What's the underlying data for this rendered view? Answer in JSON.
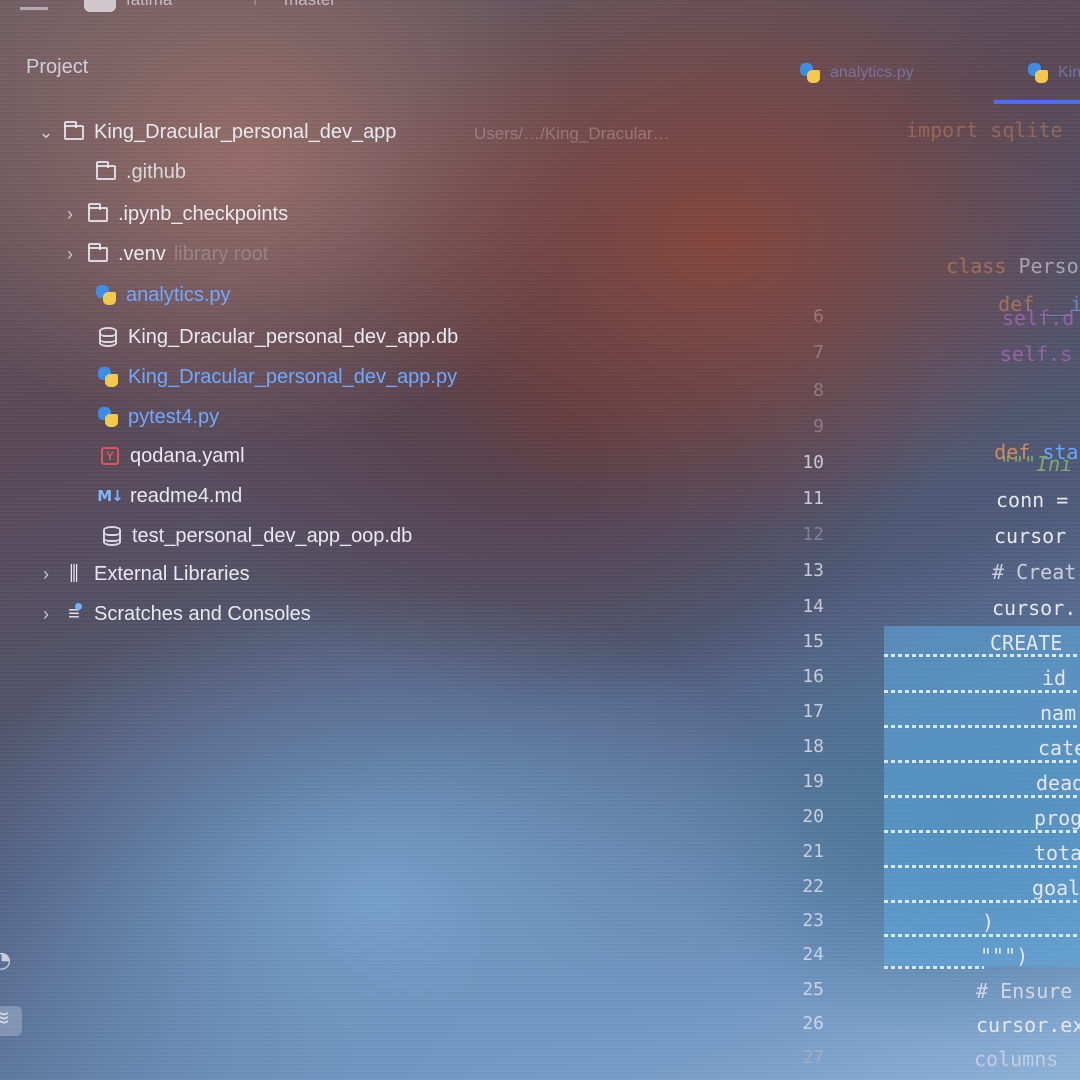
{
  "topbar": {
    "project_name": "fatima",
    "branch": "master"
  },
  "project_panel": {
    "title": "Project",
    "root": {
      "name": "King_Dracular_personal_dev_app",
      "path_hint": "Users/…/King_Dracular…"
    },
    "items": [
      {
        "name": ".github",
        "type": "folder"
      },
      {
        "name": ".ipynb_checkpoints",
        "type": "folder"
      },
      {
        "name": ".venv",
        "type": "folder",
        "suffix": "library root"
      },
      {
        "name": "analytics.py",
        "type": "python"
      },
      {
        "name": "King_Dracular_personal_dev_app.db",
        "type": "database"
      },
      {
        "name": "King_Dracular_personal_dev_app.py",
        "type": "python"
      },
      {
        "name": "pytest4.py",
        "type": "python"
      },
      {
        "name": "qodana.yaml",
        "type": "yaml"
      },
      {
        "name": "readme4.md",
        "type": "markdown"
      },
      {
        "name": "test_personal_dev_app_oop.db",
        "type": "database"
      }
    ],
    "external_libraries": "External Libraries",
    "scratches": "Scratches and Consoles"
  },
  "editor": {
    "tabs": [
      {
        "label": "analytics.py"
      },
      {
        "label": "King"
      }
    ],
    "line_numbers": [
      "6",
      "7",
      "8",
      "9",
      "10",
      "11",
      "12",
      "13",
      "14",
      "15",
      "16",
      "17",
      "18",
      "19",
      "20",
      "21",
      "22",
      "23",
      "24",
      "25",
      "26",
      "27"
    ],
    "code": {
      "import": "import sqlite",
      "class_kw": "class",
      "class_name": "Personal",
      "def_init_kw": "def",
      "def_init_name": "__init",
      "self_d": "self.d",
      "self_s": "self.s",
      "def_start_kw": "def",
      "def_start_name": "start_",
      "docstring": "\"\"\"Ini",
      "conn": "conn =",
      "cursor": "cursor",
      "comment_create": "# Creat",
      "cursor_exec": "cursor.",
      "sql_create": "CREATE",
      "sql_id": "id",
      "sql_name": "nam",
      "sql_cat": "cate",
      "sql_dead": "dead",
      "sql_prog": "prog",
      "sql_total": "tota",
      "sql_goal": "goal",
      "close_paren": ")",
      "close_doc": "\"\"\")",
      "comment_ensure": "# Ensure",
      "cursor_ex": "cursor.ex",
      "columns": "columns"
    }
  }
}
